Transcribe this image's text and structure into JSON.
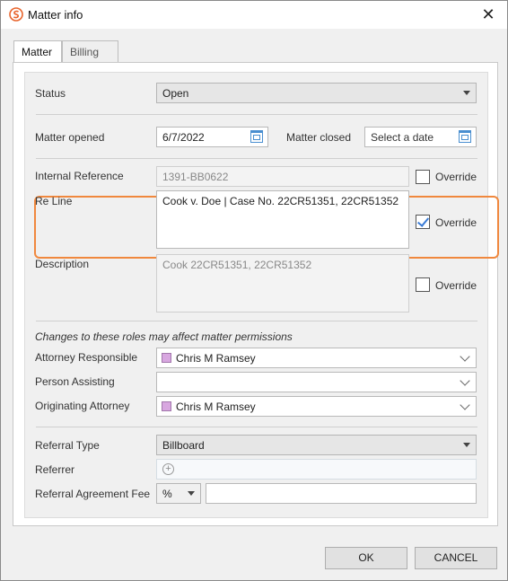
{
  "window": {
    "title": "Matter info",
    "close_glyph": "✕"
  },
  "tabs": [
    {
      "label": "Matter"
    },
    {
      "label": "Billing"
    }
  ],
  "form": {
    "status_label": "Status",
    "status_value": "Open",
    "matter_opened_label": "Matter opened",
    "matter_opened_value": "6/7/2022",
    "matter_closed_label": "Matter closed",
    "matter_closed_placeholder": "Select a date",
    "internal_reference_label": "Internal Reference",
    "internal_reference_value": "1391-BB0622",
    "override_label": "Override",
    "re_line_label": "Re Line",
    "re_line_value": "Cook v. Doe | Case No. 22CR51351, 22CR51352",
    "description_label": "Description",
    "description_value": "Cook 22CR51351, 22CR51352",
    "roles_note": "Changes to these roles may affect matter permissions",
    "attorney_responsible_label": "Attorney Responsible",
    "attorney_responsible_value": "Chris M Ramsey",
    "person_assisting_label": "Person Assisting",
    "person_assisting_value": "",
    "originating_attorney_label": "Originating Attorney",
    "originating_attorney_value": "Chris M Ramsey",
    "referral_type_label": "Referral Type",
    "referral_type_value": "Billboard",
    "referrer_label": "Referrer",
    "referral_fee_label": "Referral Agreement Fee",
    "referral_fee_unit": "%",
    "referral_fee_value": ""
  },
  "checkboxes": {
    "internal_reference_override": false,
    "re_line_override": true,
    "description_override": false
  },
  "buttons": {
    "ok": "OK",
    "cancel": "CANCEL"
  },
  "colors": {
    "highlight": "#f0883e",
    "check": "#3a7bd5",
    "person_swatch": "#d8a7e0",
    "app_icon": "#e8632b"
  }
}
